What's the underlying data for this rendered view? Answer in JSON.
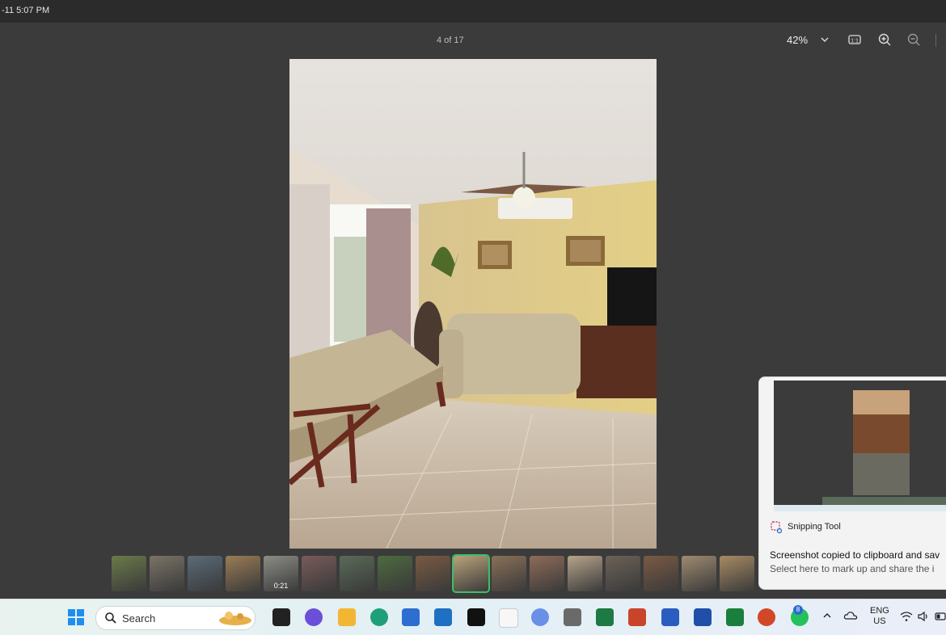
{
  "titlebar": {
    "timestamp": "-11 5:07 PM"
  },
  "toolbar": {
    "page_counter": "4 of 17",
    "zoom_value": "42%",
    "icons": [
      "chevron-down-icon",
      "actual-size-icon",
      "zoom-in-icon",
      "zoom-out-icon"
    ]
  },
  "filmstrip": {
    "thumbnails": [
      {
        "tone": "#6a7a4a"
      },
      {
        "tone": "#7a7466"
      },
      {
        "tone": "#5a6b78"
      },
      {
        "tone": "#9a7c55"
      },
      {
        "tone": "#8c8c86",
        "duration": "0:21"
      },
      {
        "tone": "#7a5a5a"
      },
      {
        "tone": "#5a6a58"
      },
      {
        "tone": "#4d6b3f"
      },
      {
        "tone": "#7a5a42"
      },
      {
        "tone": "#b9a37a",
        "selected": true
      },
      {
        "tone": "#8a7058"
      },
      {
        "tone": "#8e6c58"
      },
      {
        "tone": "#b7a48a"
      },
      {
        "tone": "#6c6258"
      },
      {
        "tone": "#7a5a44"
      },
      {
        "tone": "#9e8b70"
      },
      {
        "tone": "#a88a64"
      }
    ]
  },
  "toast": {
    "app_name": "Snipping Tool",
    "message": "Screenshot copied to clipboard and sav",
    "sub_message": "Select here to mark up and share the i"
  },
  "taskbar": {
    "search_label": "Search",
    "apps": [
      "windows-start-icon",
      "task-view-icon",
      "copilot-icon",
      "file-explorer-icon",
      "edge-icon",
      "store-icon",
      "mail-icon",
      "dropbox-icon",
      "amazon-icon",
      "photos-icon",
      "calculator-icon",
      "excel-icon",
      "powerpoint-icon",
      "word-icon",
      "word-alt-icon",
      "excel-alt-icon",
      "powerpoint-alt-icon",
      "whatsapp-icon"
    ],
    "whatsapp_badge": "8",
    "language": "ENG",
    "region": "US"
  }
}
